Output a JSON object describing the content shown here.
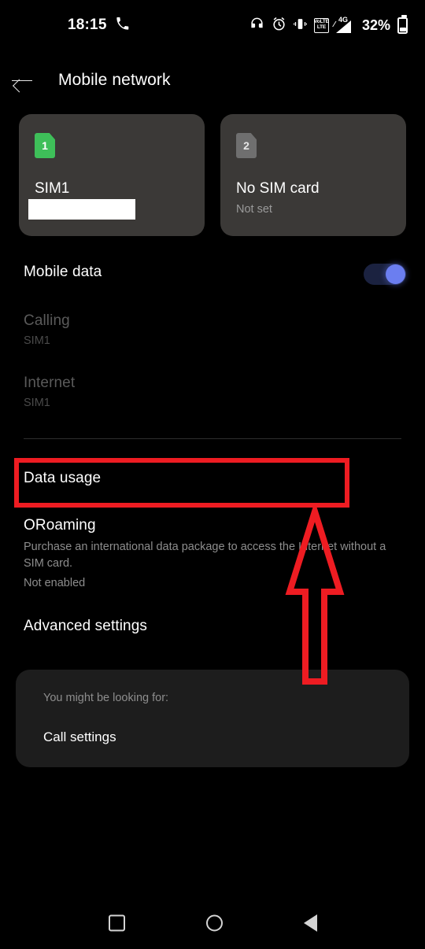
{
  "status_bar": {
    "time": "18:15",
    "phone_icon": "phone-handset-icon",
    "icons": [
      "headphones-icon",
      "alarm-icon",
      "vibrate-icon",
      "volte-icon",
      "signal-4g-icon"
    ],
    "volte_top": "VoLTE",
    "volte_bottom": "LTE",
    "network_type": "4G",
    "battery_percent": "32%"
  },
  "app_bar": {
    "back_icon": "back-arrow-icon",
    "title": "Mobile network"
  },
  "sim_cards": [
    {
      "badge": "1",
      "name": "SIM1",
      "subtitle": "",
      "redacted": true,
      "badge_color": "#3ebf59"
    },
    {
      "badge": "2",
      "name": "No SIM card",
      "subtitle": "Not set",
      "redacted": false,
      "badge_color": "#6f6f6f"
    }
  ],
  "settings": {
    "mobile_data": {
      "label": "Mobile data",
      "enabled": true,
      "accent": "#6b7ef0"
    },
    "calling": {
      "label": "Calling",
      "value": "SIM1",
      "disabled": true
    },
    "internet": {
      "label": "Internet",
      "value": "SIM1",
      "disabled": true
    },
    "data_usage": {
      "label": "Data usage",
      "highlighted": true
    },
    "oroaming": {
      "label": "ORoaming",
      "description": "Purchase an international data package to access the Internet without a SIM card.",
      "status": "Not enabled"
    },
    "advanced_settings": {
      "label": "Advanced settings"
    }
  },
  "suggestion_card": {
    "label": "You might be looking for:",
    "item": "Call settings"
  },
  "annotations": {
    "highlight_color": "#ee1c22",
    "highlight_target": "Data usage",
    "arrow": "up-arrow-pointing-to-data-usage"
  },
  "nav_bar": {
    "recents": "recents-square-icon",
    "home": "home-circle-icon",
    "back": "back-triangle-icon"
  }
}
